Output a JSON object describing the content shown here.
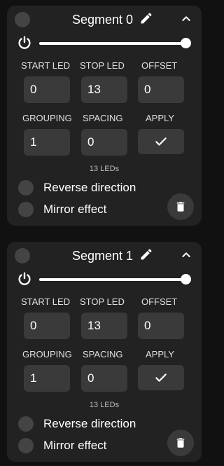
{
  "labels": {
    "start_led": "START LED",
    "stop_led": "STOP LED",
    "offset": "OFFSET",
    "grouping": "GROUPING",
    "spacing": "SPACING",
    "apply": "APPLY",
    "reverse": "Reverse direction",
    "mirror": "Mirror effect"
  },
  "segments": [
    {
      "title": "Segment 0",
      "brightness_percent": 100,
      "start_led": "0",
      "stop_led": "13",
      "offset": "0",
      "grouping": "1",
      "spacing": "0",
      "led_count": "13 LEDs",
      "reverse": false,
      "mirror": false
    },
    {
      "title": "Segment 1",
      "brightness_percent": 100,
      "start_led": "0",
      "stop_led": "13",
      "offset": "0",
      "grouping": "1",
      "spacing": "0",
      "led_count": "13 LEDs",
      "reverse": false,
      "mirror": false
    }
  ],
  "icons": {
    "select": "circle-toggle-icon",
    "edit": "pencil-icon",
    "collapse": "chevron-up-icon",
    "power": "power-icon",
    "apply": "checkmark-icon",
    "delete": "trash-icon"
  },
  "colors": {
    "background": "#111111",
    "card": "#222222",
    "field": "#3a3a3a",
    "toggle": "#444444",
    "text": "#ffffff"
  }
}
